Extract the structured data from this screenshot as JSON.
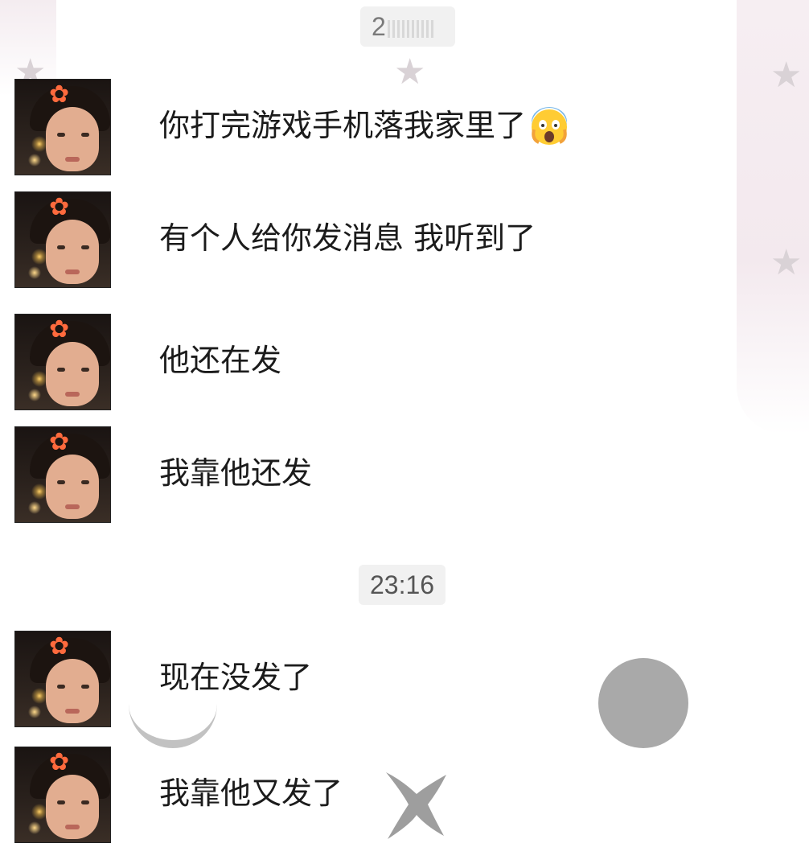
{
  "chat": {
    "timestamps": [
      {
        "id": "top",
        "text": "2"
      },
      {
        "id": "mid",
        "text": "23:16"
      }
    ],
    "messages": [
      {
        "text": "你打完游戏手机落我家里了",
        "emoji": "screaming-face"
      },
      {
        "text": "有个人给你发消息 我听到了"
      },
      {
        "text": "他还在发"
      },
      {
        "text": "我靠他还发"
      },
      {
        "text": "现在没发了"
      },
      {
        "text": "我靠他又发了"
      }
    ]
  },
  "colors": {
    "background": "#ffffff",
    "bubble": "#ffffff",
    "time_pill": "#f1f1f1",
    "text": "#1b1b1b"
  }
}
